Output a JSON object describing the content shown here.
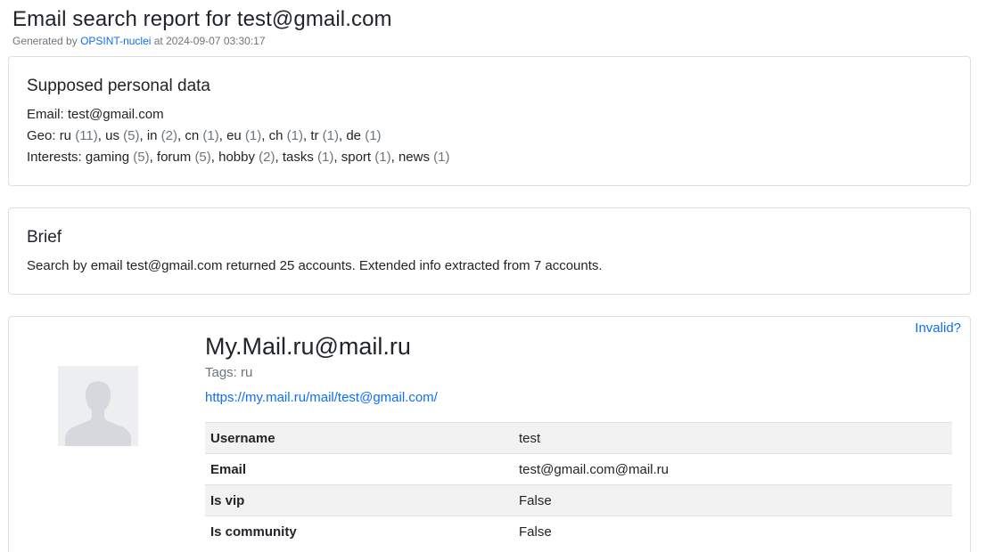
{
  "header": {
    "title": "Email search report for test@gmail.com",
    "generated_prefix": "Generated by ",
    "generator_name": "OPSINT-nuclei",
    "generated_suffix": " at 2024-09-07 03:30:17"
  },
  "personal": {
    "title": "Supposed personal data",
    "email_label": "Email: ",
    "email": "test@gmail.com",
    "geo_label": "Geo: ",
    "geo": [
      {
        "name": "ru",
        "count": "(11)"
      },
      {
        "name": "us",
        "count": "(5)"
      },
      {
        "name": "in",
        "count": "(2)"
      },
      {
        "name": "cn",
        "count": "(1)"
      },
      {
        "name": "eu",
        "count": "(1)"
      },
      {
        "name": "ch",
        "count": "(1)"
      },
      {
        "name": "tr",
        "count": "(1)"
      },
      {
        "name": "de",
        "count": "(1)"
      }
    ],
    "interests_label": "Interests: ",
    "interests": [
      {
        "name": "gaming",
        "count": "(5)"
      },
      {
        "name": "forum",
        "count": "(5)"
      },
      {
        "name": "hobby",
        "count": "(2)"
      },
      {
        "name": "tasks",
        "count": "(1)"
      },
      {
        "name": "sport",
        "count": "(1)"
      },
      {
        "name": "news",
        "count": "(1)"
      }
    ]
  },
  "brief": {
    "title": "Brief",
    "text": "Search by email test@gmail.com returned 25 accounts. Extended info extracted from 7 accounts."
  },
  "account": {
    "invalid_label": "Invalid?",
    "title": "My.Mail.ru@mail.ru",
    "tags": "Tags: ru",
    "url": "https://my.mail.ru/mail/test@gmail.com/",
    "avatar_icon": "default-user-avatar-icon",
    "fields": [
      {
        "key": "Username",
        "value": "test"
      },
      {
        "key": "Email",
        "value": "test@gmail.com@mail.ru"
      },
      {
        "key": "Is vip",
        "value": "False"
      },
      {
        "key": "Is community",
        "value": "False"
      }
    ]
  }
}
